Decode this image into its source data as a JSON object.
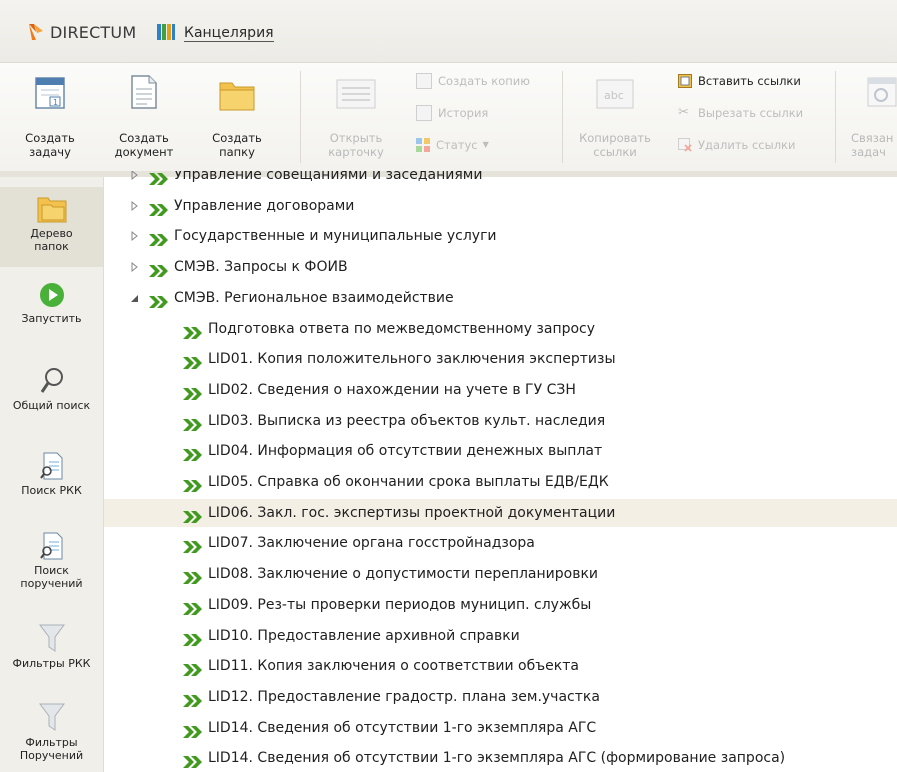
{
  "titlebar": {
    "logo_text": "DIRECTUM",
    "app_name": "Канцелярия"
  },
  "ribbon": {
    "create_task": "Создать\nзадачу",
    "create_document": "Создать\nдокумент",
    "create_folder": "Создать\nпапку",
    "open_card": "Открыть\nкарточку",
    "create_copy": "Создать копию",
    "history": "История",
    "status": "Статус",
    "copy_links": "Копировать\nссылки",
    "insert_links": "Вставить ссылки",
    "cut_links": "Вырезать ссылки",
    "delete_links": "Удалить ссылки",
    "related_tasks": "Связан\nзадач"
  },
  "sidebar": {
    "items": [
      {
        "label": "Дерево\nпапок",
        "icon": "folder-tree-icon"
      },
      {
        "label": "Запустить",
        "icon": "play-icon"
      },
      {
        "label": "Общий поиск",
        "icon": "search-icon"
      },
      {
        "label": "Поиск РКК",
        "icon": "search-document-icon"
      },
      {
        "label": "Поиск\nпоручений",
        "icon": "search-document-icon"
      },
      {
        "label": "Фильтры РКК",
        "icon": "filter-icon"
      },
      {
        "label": "Фильтры\nПоручений",
        "icon": "filter-icon"
      }
    ]
  },
  "tree": {
    "rows": [
      {
        "text": "Управление совещаниями и заседаниями",
        "level": 0,
        "expander": "collapsed"
      },
      {
        "text": "Управление договорами",
        "level": 0,
        "expander": "collapsed"
      },
      {
        "text": "Государственные и муниципальные услуги",
        "level": 0,
        "expander": "collapsed"
      },
      {
        "text": "СМЭВ. Запросы к ФОИВ",
        "level": 0,
        "expander": "collapsed"
      },
      {
        "text": "СМЭВ. Региональное взаимодействие",
        "level": 0,
        "expander": "expanded"
      },
      {
        "text": " Подготовка ответа по межведомственному запросу",
        "level": 1
      },
      {
        "text": "LID01. Копия положительного заключения экспертизы",
        "level": 1
      },
      {
        "text": "LID02. Сведения о нахождении на учете в ГУ СЗН",
        "level": 1
      },
      {
        "text": "LID03. Выписка из реестра объектов культ. наследия",
        "level": 1
      },
      {
        "text": "LID04. Информация об отсутствии денежных выплат",
        "level": 1
      },
      {
        "text": "LID05. Справка об окончании срока выплаты ЕДВ/ЕДК",
        "level": 1
      },
      {
        "text": "LID06. Закл. гос. экспертизы проектной документации",
        "level": 1,
        "selected": true
      },
      {
        "text": "LID07. Заключение органа госстройнадзора",
        "level": 1
      },
      {
        "text": "LID08. Заключение о допустимости перепланировки",
        "level": 1
      },
      {
        "text": "LID09. Рез-ты проверки периодов муницип. службы",
        "level": 1
      },
      {
        "text": "LID10. Предоставление архивной справки",
        "level": 1
      },
      {
        "text": "LID11. Копия заключения о соответствии объекта",
        "level": 1
      },
      {
        "text": "LID12. Предоставление градостр. плана зем.участка",
        "level": 1
      },
      {
        "text": "LID14. Сведения об отсутствии 1-го экземпляра АГС",
        "level": 1
      },
      {
        "text": "LID14. Сведения об отсутствии 1-го экземпляра АГС (формирование запроса)",
        "level": 1
      }
    ]
  },
  "colors": {
    "chevron_green": "#3f9a1e",
    "selection": "#f3efe4",
    "sidebar_bg": "#f0efe9",
    "logo_orange": "#f07b16"
  }
}
